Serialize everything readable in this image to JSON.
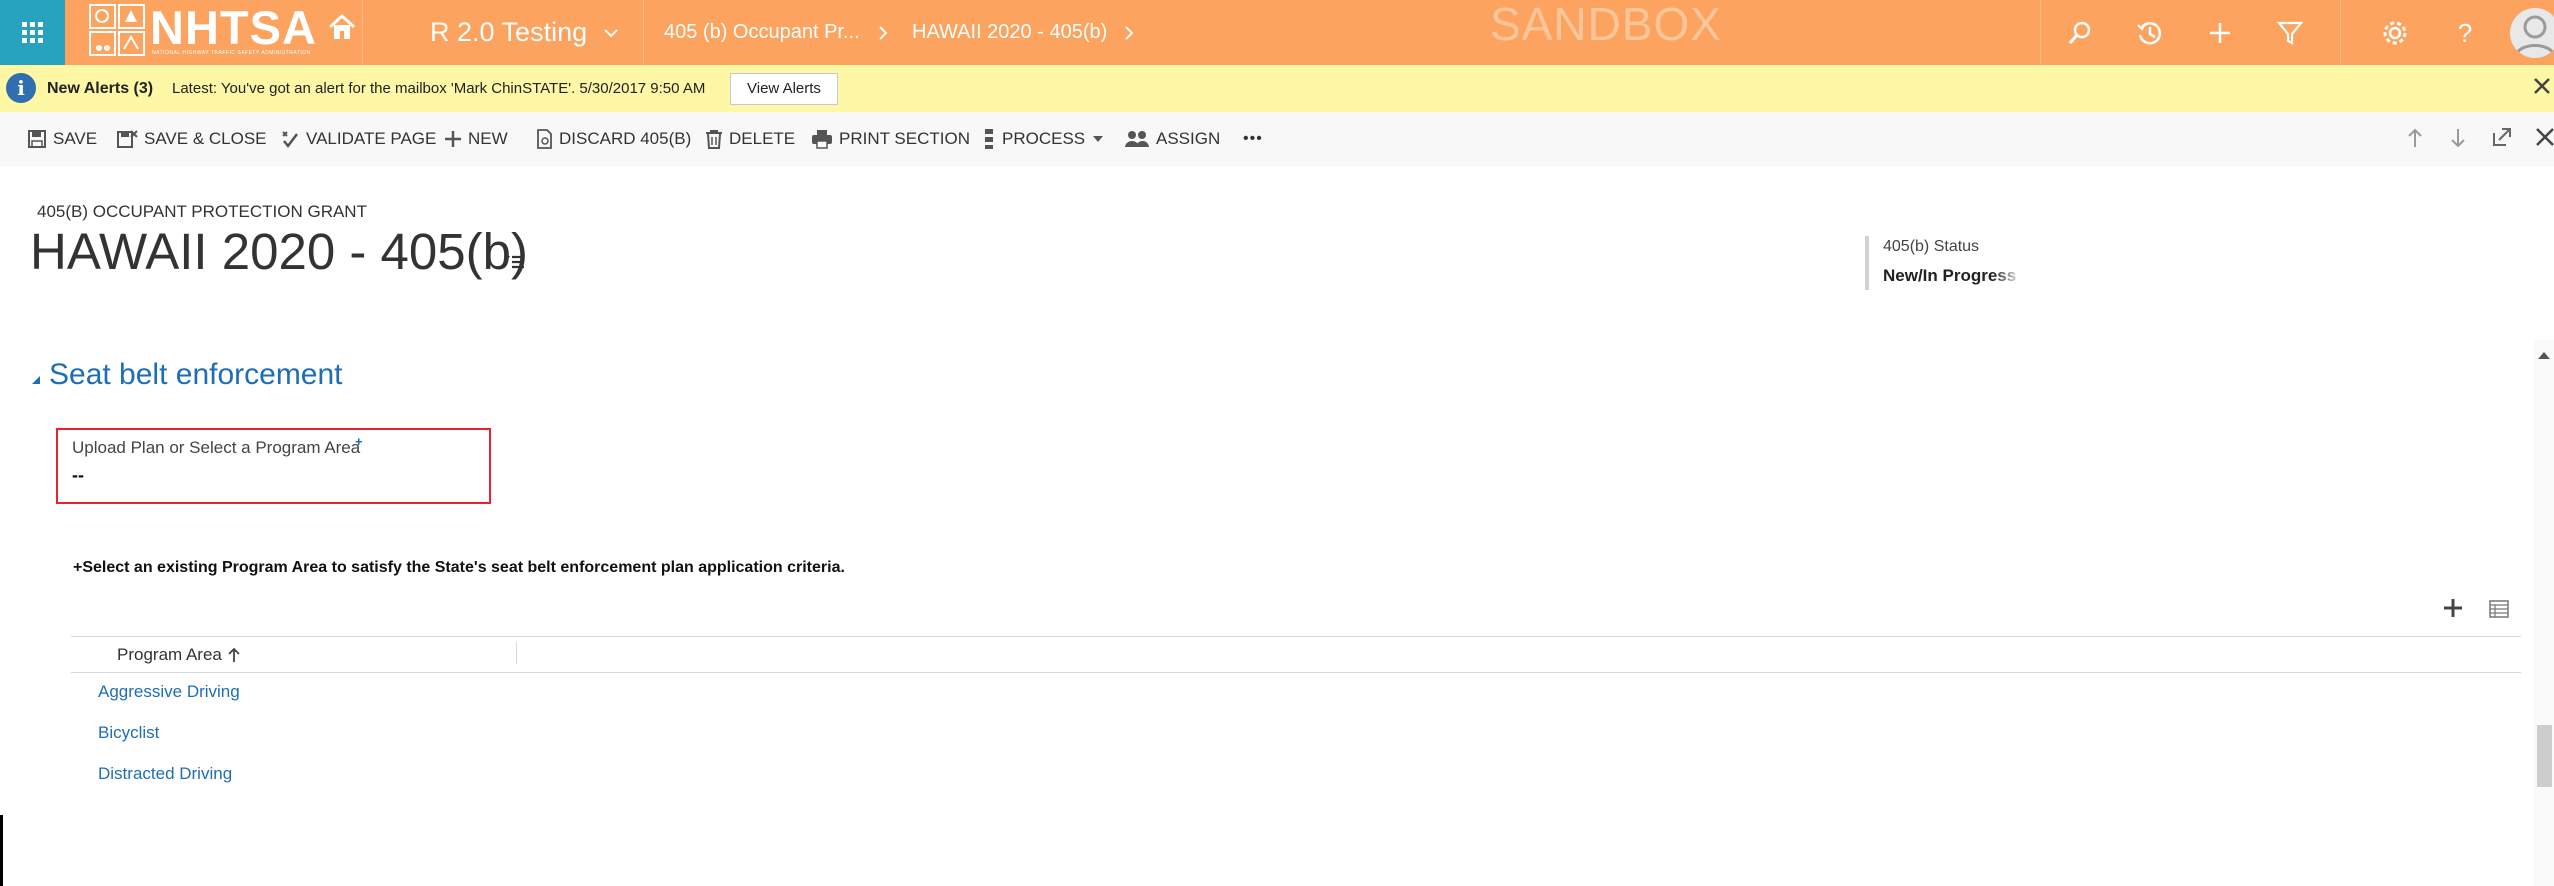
{
  "topbar": {
    "logo_text": "NHTSA",
    "logo_subtitle": "NATIONAL HIGHWAY TRAFFIC SAFETY ADMINISTRATION",
    "app_name": "R 2.0 Testing",
    "breadcrumbs": [
      "405 (b) Occupant Pr...",
      "HAWAII 2020 - 405(b)"
    ],
    "environment": "SANDBOX",
    "icons": [
      "search-icon",
      "history-icon",
      "plus-icon",
      "filter-icon",
      "settings-icon",
      "help-icon",
      "user-avatar"
    ]
  },
  "alert": {
    "title": "New Alerts (3)",
    "message": "Latest: You've got an alert for the mailbox 'Mark ChinSTATE'. 5/30/2017 9:50 AM",
    "button": "View Alerts"
  },
  "commands": {
    "save": "SAVE",
    "save_close": "SAVE & CLOSE",
    "validate": "VALIDATE PAGE",
    "new": "NEW",
    "discard": "DISCARD 405(B)",
    "delete": "DELETE",
    "print": "PRINT SECTION",
    "process": "PROCESS",
    "assign": "ASSIGN",
    "more": "•••"
  },
  "header": {
    "entity_type": "405(B) OCCUPANT PROTECTION GRANT",
    "record_title": "HAWAII 2020 - 405(b)",
    "status_label": "405(b) Status",
    "status_value": "New/In Progress"
  },
  "section": {
    "title": "Seat belt enforcement",
    "field": {
      "label": "Upload Plan or Select a Program Area",
      "required_marker": "+",
      "value": "--"
    },
    "instruction": "+Select an existing Program Area to satisfy the State's seat belt enforcement plan application criteria.",
    "grid": {
      "column_header": "Program Area",
      "rows": [
        "Aggressive Driving",
        "Bicyclist",
        "Distracted Driving"
      ]
    }
  },
  "colors": {
    "topbar": "#fca35f",
    "waffle": "#27a2bf",
    "alert_bg": "#fdf7a6",
    "link": "#1e6eb6",
    "highlight": "#e6232e"
  }
}
